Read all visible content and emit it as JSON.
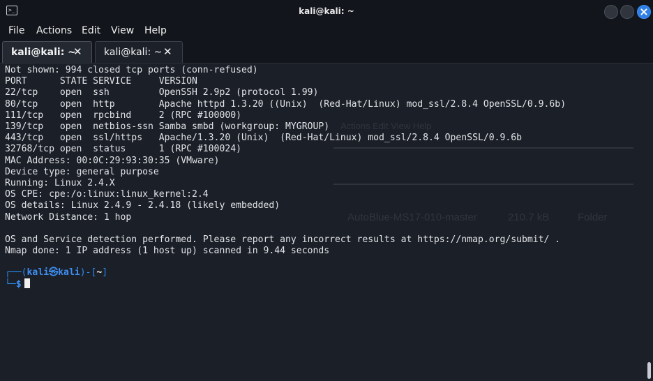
{
  "window": {
    "title": "kali@kali: ~"
  },
  "menu": [
    "File",
    "Actions",
    "Edit",
    "View",
    "Help"
  ],
  "tabs": [
    {
      "label": "kali@kali: ~",
      "close": "✕"
    },
    {
      "label": "kali@kali: ~",
      "close": "✕"
    }
  ],
  "terminal": {
    "output": "Not shown: 994 closed tcp ports (conn-refused)\nPORT      STATE SERVICE     VERSION\n22/tcp    open  ssh         OpenSSH 2.9p2 (protocol 1.99)\n80/tcp    open  http        Apache httpd 1.3.20 ((Unix)  (Red-Hat/Linux) mod_ssl/2.8.4 OpenSSL/0.9.6b)\n111/tcp   open  rpcbind     2 (RPC #100000)\n139/tcp   open  netbios-ssn Samba smbd (workgroup: MYGROUP)\n443/tcp   open  ssl/https   Apache/1.3.20 (Unix)  (Red-Hat/Linux) mod_ssl/2.8.4 OpenSSL/0.9.6b\n32768/tcp open  status      1 (RPC #100024)\nMAC Address: 00:0C:29:93:30:35 (VMware)\nDevice type: general purpose\nRunning: Linux 2.4.X\nOS CPE: cpe:/o:linux:linux_kernel:2.4\nOS details: Linux 2.4.9 - 2.4.18 (likely embedded)\nNetwork Distance: 1 hop\n\nOS and Service detection performed. Please report any incorrect results at https://nmap.org/submit/ .\nNmap done: 1 IP address (1 host up) scanned in 9.44 seconds",
    "prompt": {
      "frame_top": "┌──(",
      "user_host": "kali㉿kali",
      "sep": ")-[",
      "dir": "~",
      "close": "]",
      "frame_bottom": "└─",
      "dollar": "$"
    }
  },
  "background_window": {
    "menu_text": "Actions  Edit  View  Help",
    "file_name": "AutoBlue-MS17-010-master",
    "file_size": "210.7 kB",
    "file_type": "Folder"
  }
}
